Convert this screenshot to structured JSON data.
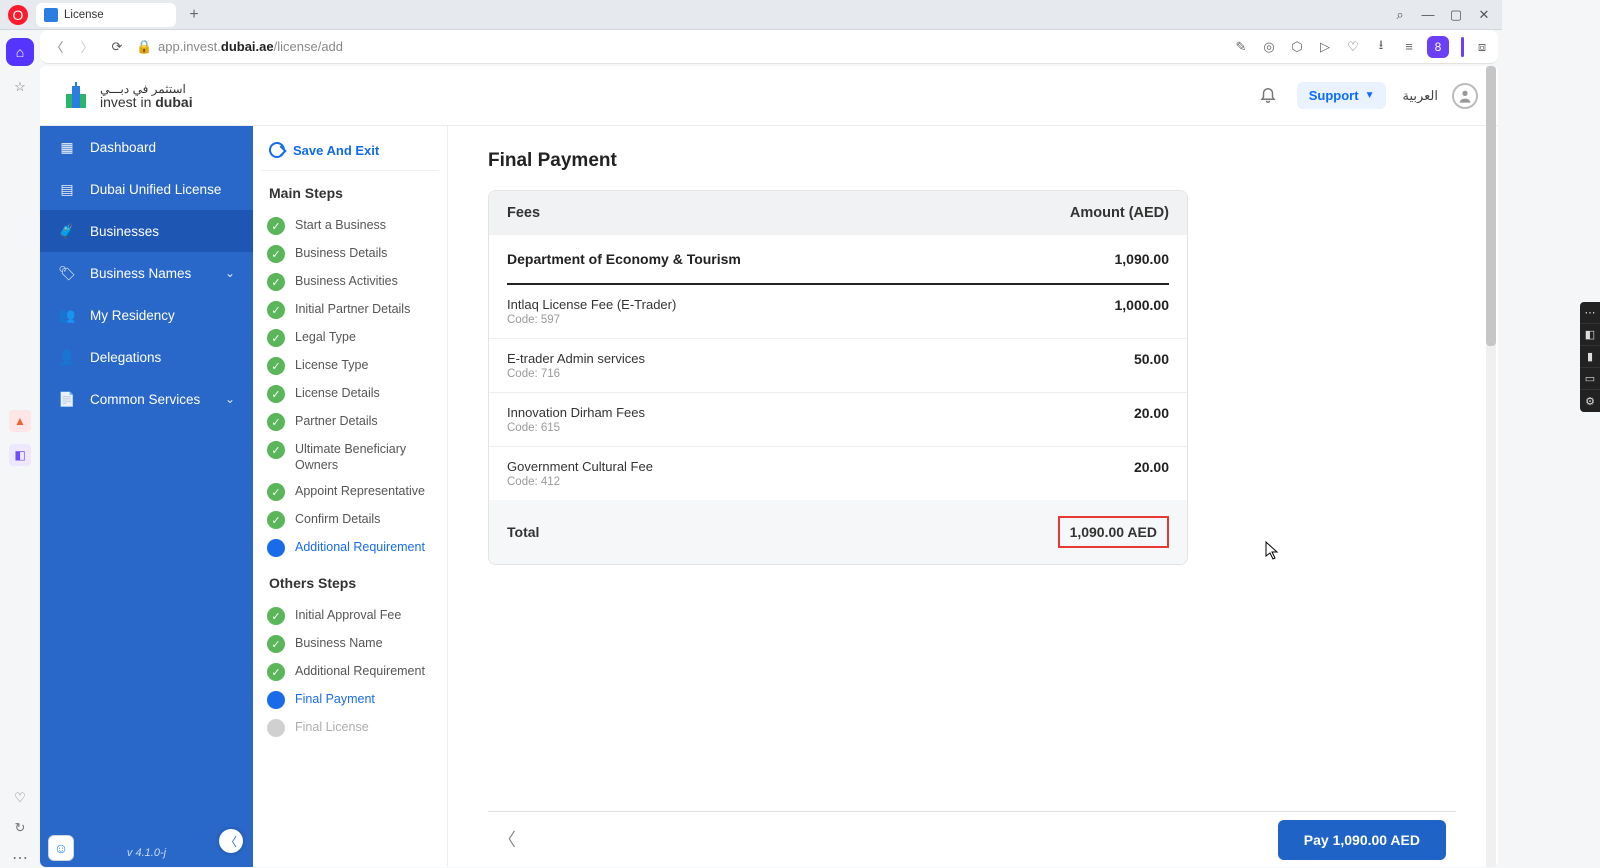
{
  "browser": {
    "tab_title": "License",
    "url_host": "dubai.ae",
    "url_pre": "app.invest.",
    "url_path": "/license/add"
  },
  "header": {
    "logo_ar": "استثمر في دبـــي",
    "logo_en_pre": "invest in ",
    "logo_en_bold": "dubai",
    "support": "Support",
    "language": "العربية"
  },
  "sidebar": {
    "items": [
      {
        "id": "dashboard",
        "label": "Dashboard"
      },
      {
        "id": "dul",
        "label": "Dubai Unified License"
      },
      {
        "id": "businesses",
        "label": "Businesses",
        "active": true
      },
      {
        "id": "names",
        "label": "Business Names",
        "expandable": true
      },
      {
        "id": "residency",
        "label": "My Residency"
      },
      {
        "id": "delegations",
        "label": "Delegations"
      },
      {
        "id": "common",
        "label": "Common Services",
        "expandable": true
      }
    ],
    "version": "v 4.1.0-j"
  },
  "steps": {
    "save_exit": "Save And Exit",
    "main_title": "Main Steps",
    "others_title": "Others Steps",
    "main": [
      {
        "label": "Start a Business",
        "state": "done"
      },
      {
        "label": "Business Details",
        "state": "done"
      },
      {
        "label": "Business Activities",
        "state": "done"
      },
      {
        "label": "Initial Partner Details",
        "state": "done"
      },
      {
        "label": "Legal Type",
        "state": "done"
      },
      {
        "label": "License Type",
        "state": "done"
      },
      {
        "label": "License Details",
        "state": "done"
      },
      {
        "label": "Partner Details",
        "state": "done"
      },
      {
        "label": "Ultimate Beneficiary Owners",
        "state": "done"
      },
      {
        "label": "Appoint Representative",
        "state": "done"
      },
      {
        "label": "Confirm Details",
        "state": "done"
      },
      {
        "label": "Additional Requirement",
        "state": "active"
      }
    ],
    "others": [
      {
        "label": "Initial Approval Fee",
        "state": "done"
      },
      {
        "label": "Business Name",
        "state": "done"
      },
      {
        "label": "Additional Requirement",
        "state": "done"
      },
      {
        "label": "Final Payment",
        "state": "active"
      },
      {
        "label": "Final License",
        "state": "pending"
      }
    ]
  },
  "page": {
    "title": "Final Payment",
    "fees_label": "Fees",
    "amount_label": "Amount (AED)",
    "dept_name": "Department of Economy & Tourism",
    "dept_total": "1,090.00",
    "fees": [
      {
        "name": "Intlaq License Fee (E-Trader)",
        "code": "Code: 597",
        "amount": "1,000.00"
      },
      {
        "name": "E-trader Admin services",
        "code": "Code: 716",
        "amount": "50.00"
      },
      {
        "name": "Innovation Dirham Fees",
        "code": "Code: 615",
        "amount": "20.00"
      },
      {
        "name": "Government Cultural Fee",
        "code": "Code: 412",
        "amount": "20.00"
      }
    ],
    "total_label": "Total",
    "total_value": "1,090.00 AED",
    "pay_button": "Pay 1,090.00 AED"
  }
}
